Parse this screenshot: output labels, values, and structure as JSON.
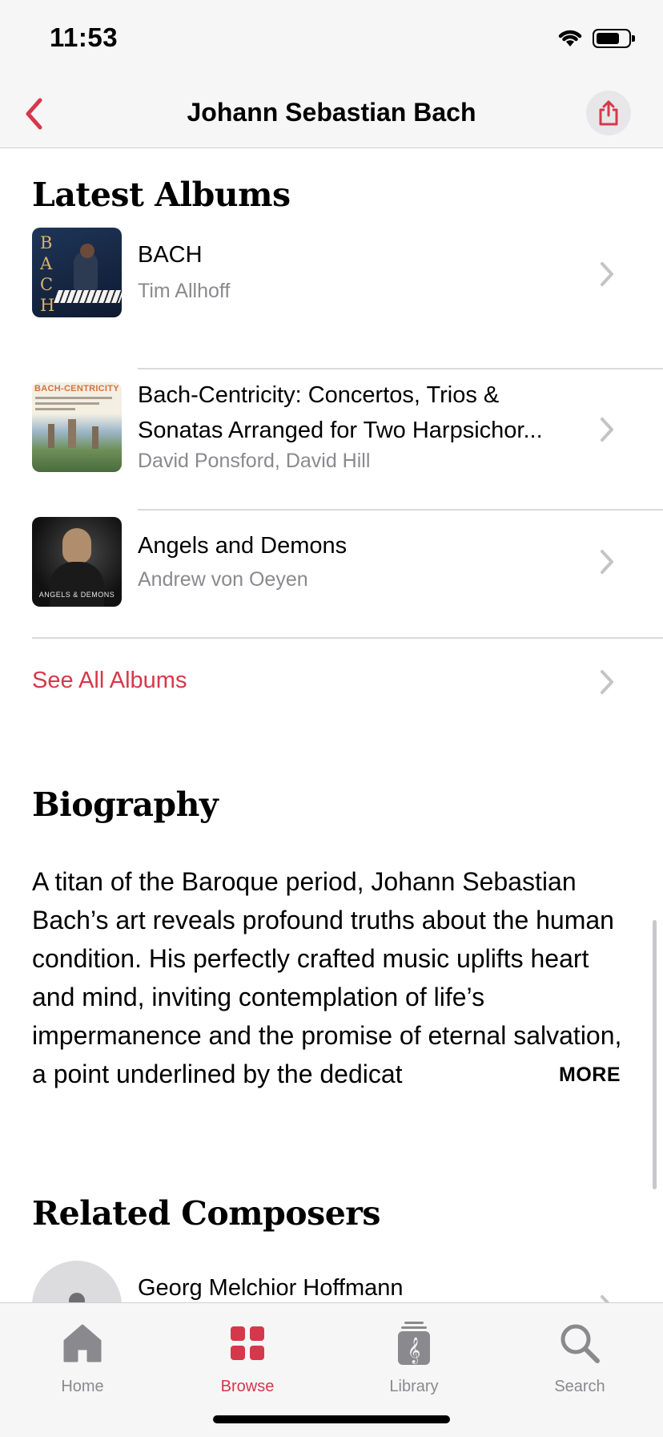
{
  "status_bar": {
    "time": "11:53"
  },
  "nav": {
    "title": "Johann Sebastian Bach"
  },
  "latest_albums": {
    "heading": "Latest Albums",
    "albums": [
      {
        "title": "BACH",
        "artist": "Tim Allhoff",
        "art_letters": [
          "B",
          "A",
          "C",
          "H"
        ]
      },
      {
        "title": "Bach-Centricity: Concertos, Trios & Sonatas Arranged for Two Harpsichor...",
        "artist": "David Ponsford, David Hill",
        "art_title": "BACH-CENTRICITY"
      },
      {
        "title": "Angels and Demons",
        "artist": "Andrew von Oeyen",
        "art_caption": "ANGELS & DEMONS"
      }
    ],
    "see_all": "See All Albums"
  },
  "biography": {
    "heading": "Biography",
    "text": "A titan of the Baroque period, Johann Sebastian Bach’s art reveals profound truths about the human condition. His perfectly crafted music uplifts heart and mind, inviting contemplation of life’s impermanence and the promise of eternal salvation, a point underlined by the dedicat",
    "more": "MORE"
  },
  "related_composers": {
    "heading": "Related Composers",
    "items": [
      {
        "name": "Georg Melchior Hoffmann"
      }
    ]
  },
  "tab_bar": {
    "tabs": [
      {
        "label": "Home",
        "icon": "house-icon"
      },
      {
        "label": "Browse",
        "icon": "grid-icon",
        "active": true
      },
      {
        "label": "Library",
        "icon": "library-icon"
      },
      {
        "label": "Search",
        "icon": "magnifying-glass-icon"
      }
    ]
  },
  "colors": {
    "accent": "#d6384b",
    "secondary_text": "#8a8a8e",
    "bar_background": "#f6f6f6"
  }
}
